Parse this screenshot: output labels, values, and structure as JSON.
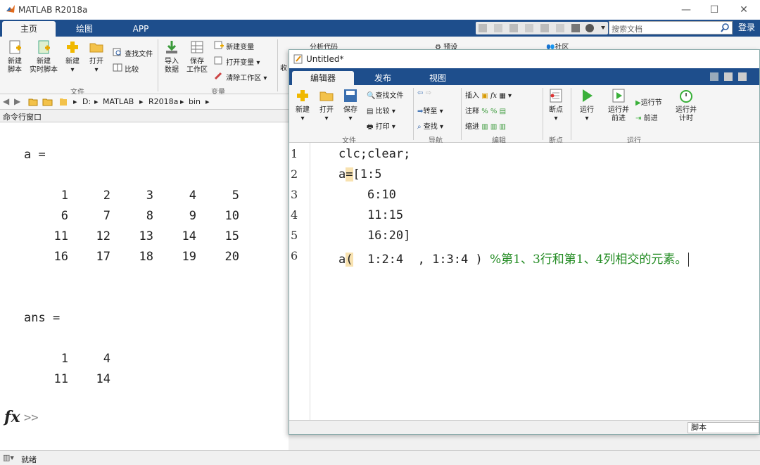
{
  "app": {
    "title": "MATLAB R2018a"
  },
  "main_tabs": [
    "主页",
    "绘图",
    "APP"
  ],
  "search": {
    "placeholder": "搜索文档"
  },
  "login_label": "登录",
  "ribbon": {
    "new_script": "新建\n脚本",
    "new_live_script": "新建\n实时脚本",
    "new": "新建",
    "open": "打开",
    "find_files": "查找文件",
    "compare": "比较",
    "import_data": "导入\n数据",
    "save_workspace": "保存\n工作区",
    "new_variable": "新建变量",
    "open_variable": "打开变量",
    "clear_workspace": "清除工作区",
    "analyze_code": "分析代码",
    "preferences": "预设",
    "community": "社区",
    "collapse_label": "收",
    "group_file": "文件",
    "group_variable": "变量"
  },
  "address": {
    "drive": "D:",
    "path": [
      "MATLAB",
      "R2018a",
      "bin"
    ]
  },
  "command_window": {
    "header": "命令行窗口",
    "var_a": "a =",
    "matrix_a": [
      [
        "1",
        "2",
        "3",
        "4",
        "5"
      ],
      [
        "6",
        "7",
        "8",
        "9",
        "10"
      ],
      [
        "11",
        "12",
        "13",
        "14",
        "15"
      ],
      [
        "16",
        "17",
        "18",
        "19",
        "20"
      ]
    ],
    "var_ans": "ans =",
    "matrix_ans": [
      [
        "1",
        "4"
      ],
      [
        "11",
        "14"
      ]
    ],
    "prompt": ">>",
    "fx": "fx"
  },
  "editor": {
    "title": "Untitled*",
    "tabs": [
      "编辑器",
      "发布",
      "视图"
    ],
    "ribbon": {
      "new": "新建",
      "open": "打开",
      "save": "保存",
      "find_files": "查找文件",
      "compare": "比较",
      "print": "打印",
      "goto": "转至",
      "find": "查找",
      "insert": "插入",
      "comment": "注释",
      "indent": "缩进",
      "breakpoints": "断点",
      "run": "运行",
      "run_advance": "运行并\n前进",
      "run_section": "运行节",
      "advance": "前进",
      "run_time": "运行并\n计时",
      "group_file": "文件",
      "group_nav": "导航",
      "group_edit": "编辑",
      "group_bp": "断点",
      "group_run": "运行"
    },
    "line_numbers": [
      "1",
      "2",
      "3",
      "4",
      "5",
      "6"
    ],
    "code": {
      "l1": "clc;clear;",
      "l2a": "a",
      "l2b": "=",
      "l2c": "[1:5",
      "l3": "    6:10",
      "l4": "    11:15",
      "l5": "    16:20]",
      "l6a": "a",
      "l6b": "(",
      "l6c": "  1:2:4  , 1:3:4 ) ",
      "l6comment": "%第1、3行和第1、4列相交的元素。"
    },
    "status_type": "脚本"
  },
  "statusbar": {
    "text": "就绪"
  },
  "colors": {
    "accent": "#1e4e8c",
    "comment": "#228b22"
  }
}
